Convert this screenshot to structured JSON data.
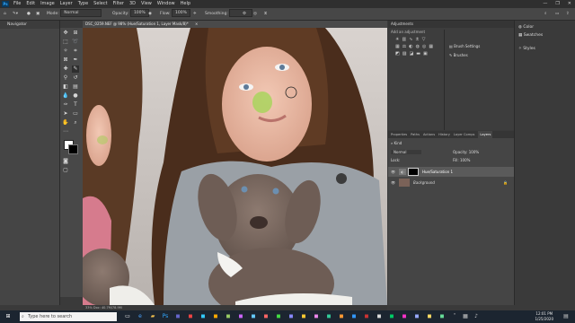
{
  "menu": {
    "logo": "Ps",
    "items": [
      "File",
      "Edit",
      "Image",
      "Layer",
      "Type",
      "Select",
      "Filter",
      "3D",
      "View",
      "Window",
      "Help"
    ],
    "controls": [
      "—",
      "❐",
      "✕"
    ]
  },
  "options": {
    "mode_label": "Mode:",
    "mode_value": "Normal",
    "opacity_label": "Opacity:",
    "opacity_value": "100%",
    "flow_label": "Flow:",
    "flow_value": "100%",
    "smoothing_label": "Smoothing:",
    "smoothing_value": ""
  },
  "navigator": {
    "title": "Navigator"
  },
  "document": {
    "tab": "DSC_0259.NEF @ 98% (Hue/Saturation 1, Layer Mask/8)*",
    "status": "33%   Doc: 40.7M/78.9M"
  },
  "adjustments": {
    "title": "Adjustments",
    "subtitle": "Add an adjustment",
    "side_items": [
      "Brush Settings",
      "Brushes"
    ]
  },
  "layers": {
    "tabs": [
      "Properties",
      "Paths",
      "Actions",
      "History",
      "Layer Comps",
      "Layers"
    ],
    "active_tab": "Layers",
    "kind": "Kind",
    "blend": "Normal",
    "opacity_label": "Opacity:",
    "opacity_value": "100%",
    "lock_label": "Lock:",
    "fill_label": "Fill:",
    "fill_value": "100%",
    "items": [
      {
        "name": "Hue/Saturation 1"
      },
      {
        "name": "Background"
      }
    ]
  },
  "right_strip": {
    "items": [
      "Color",
      "Swatches",
      "Styles"
    ]
  },
  "taskbar": {
    "search_placeholder": "Type here to search",
    "time": "12:01 PM",
    "date": "1/25/2020"
  }
}
